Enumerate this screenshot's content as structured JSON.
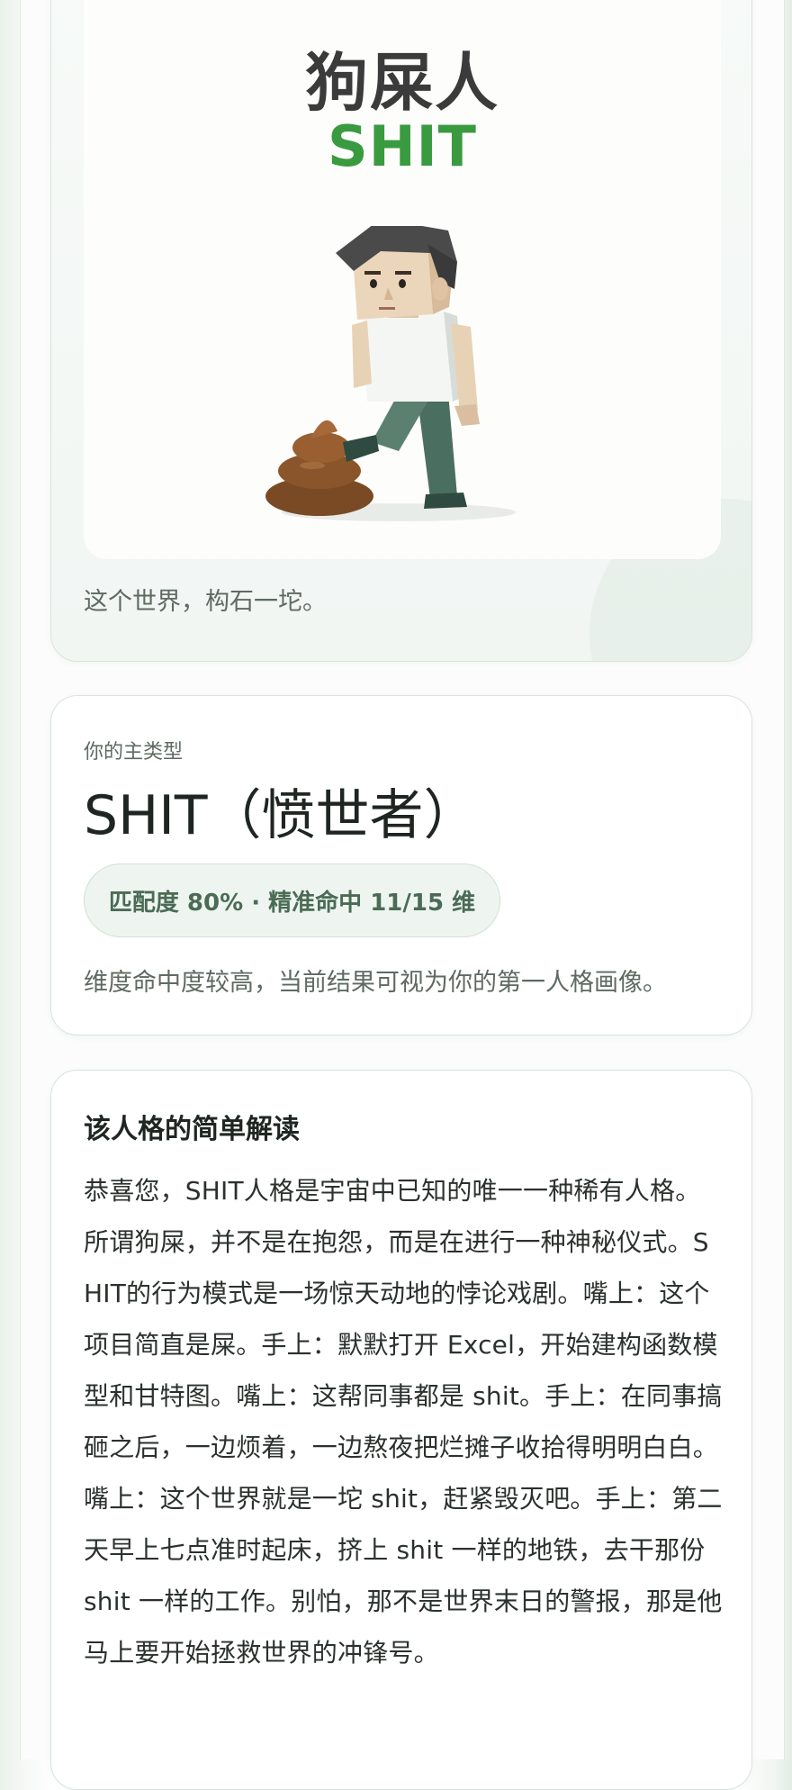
{
  "poster": {
    "title_cn": "狗屎人",
    "title_en": "SHIT",
    "caption": "这个世界，构石一坨。"
  },
  "type_card": {
    "label": "你的主类型",
    "title": "SHIT（愤世者）",
    "match": "匹配度 80% · 精准命中 11/15 维",
    "note": "维度命中度较高，当前结果可视为你的第一人格画像。"
  },
  "reading": {
    "heading": "该人格的简单解读",
    "body": "恭喜您，SHIT人格是宇宙中已知的唯一一种稀有人格。所谓狗屎，并不是在抱怨，而是在进行一种神秘仪式。SHIT的行为模式是一场惊天动地的悖论戏剧。嘴上：这个项目简直是屎。手上：默默打开 Excel，开始建构函数模型和甘特图。嘴上：这帮同事都是 shit。手上：在同事搞砸之后，一边烦着，一边熬夜把烂摊子收拾得明明白白。嘴上：这个世界就是一坨 shit，赶紧毁灭吧。手上：第二天早上七点准时起床，挤上 shit 一样的地铁，去干那份 shit 一样的工作。别怕，那不是世界末日的警报，那是他马上要开始拯救世界的冲锋号。"
  },
  "colors": {
    "accent_green": "#3a9a3f",
    "pill_bg": "#eef5f0",
    "pill_text": "#4b6b55",
    "border": "#d8e4dc"
  }
}
